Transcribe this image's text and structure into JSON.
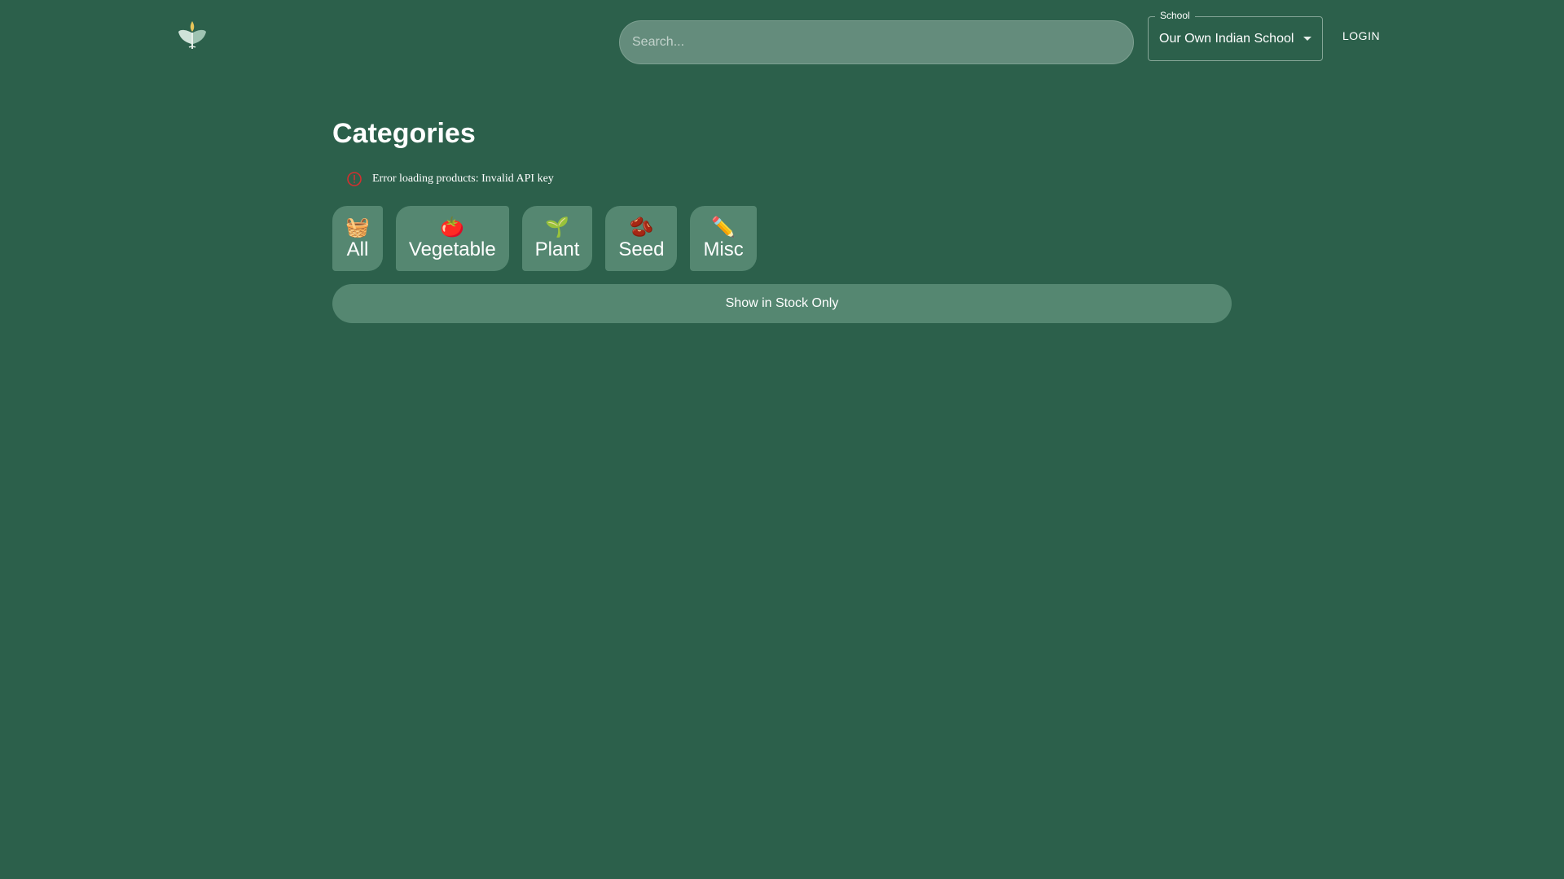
{
  "header": {
    "logo_icon": "sprout-logo-icon",
    "search": {
      "placeholder": "Search...",
      "value": ""
    },
    "school_select": {
      "label": "School",
      "value": "Our Own Indian School"
    },
    "login_label": "LOGIN"
  },
  "main": {
    "title": "Categories",
    "error": {
      "icon": "error-outline-icon",
      "message": "Error loading products: Invalid API key",
      "color": "#d32f2f"
    },
    "categories": [
      {
        "emoji": "🧺",
        "label": "All"
      },
      {
        "emoji": "🍅",
        "label": "Vegetable"
      },
      {
        "emoji": "🌱",
        "label": "Plant"
      },
      {
        "emoji": "🫘",
        "label": "Seed"
      },
      {
        "emoji": "✏️",
        "label": "Misc"
      }
    ],
    "stock_toggle_label": "Show in Stock Only"
  },
  "colors": {
    "background": "#2c604b",
    "button": "#558771",
    "search_bg": "#648c7c"
  }
}
